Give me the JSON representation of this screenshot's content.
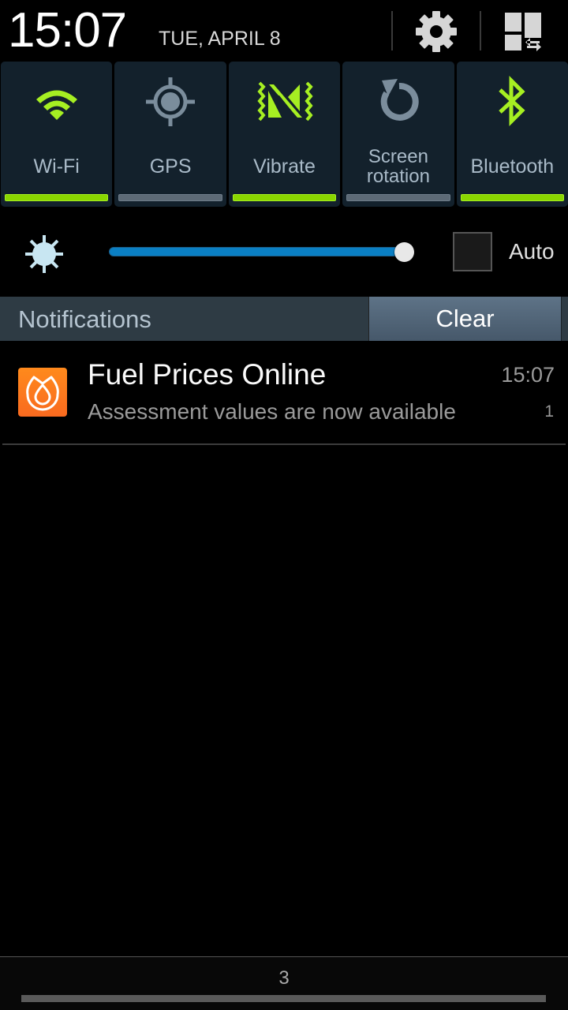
{
  "header": {
    "time": "15:07",
    "date": "TUE, APRIL 8",
    "settings_icon": "gear-icon",
    "quick_settings_icon": "quick-settings-grid-icon"
  },
  "quick_tiles": [
    {
      "label": "Wi-Fi",
      "icon": "wifi-icon",
      "enabled": true
    },
    {
      "label": "GPS",
      "icon": "gps-icon",
      "enabled": false
    },
    {
      "label": "Vibrate",
      "icon": "vibrate-icon",
      "enabled": true
    },
    {
      "label": "Screen rotation",
      "label_line1": "Screen",
      "label_line2": "rotation",
      "icon": "rotate-icon",
      "enabled": false
    },
    {
      "label": "Bluetooth",
      "icon": "bluetooth-icon",
      "enabled": true
    }
  ],
  "brightness": {
    "level_percent": 100,
    "auto_label": "Auto",
    "auto_checked": false
  },
  "notifications_header": {
    "title": "Notifications",
    "clear_label": "Clear"
  },
  "notifications": [
    {
      "app": "Fuel Prices Online",
      "text": "Assessment values are now available",
      "time": "15:07",
      "count": "1",
      "icon": "fuel-drop-icon"
    }
  ],
  "bottom": {
    "page_number": "3"
  },
  "colors": {
    "active_green": "#8ad600",
    "inactive_gray": "#5d6a76",
    "tile_bg": "#13212c",
    "slider_blue": "#0a7fc4",
    "app_orange": "#f97a1e"
  }
}
